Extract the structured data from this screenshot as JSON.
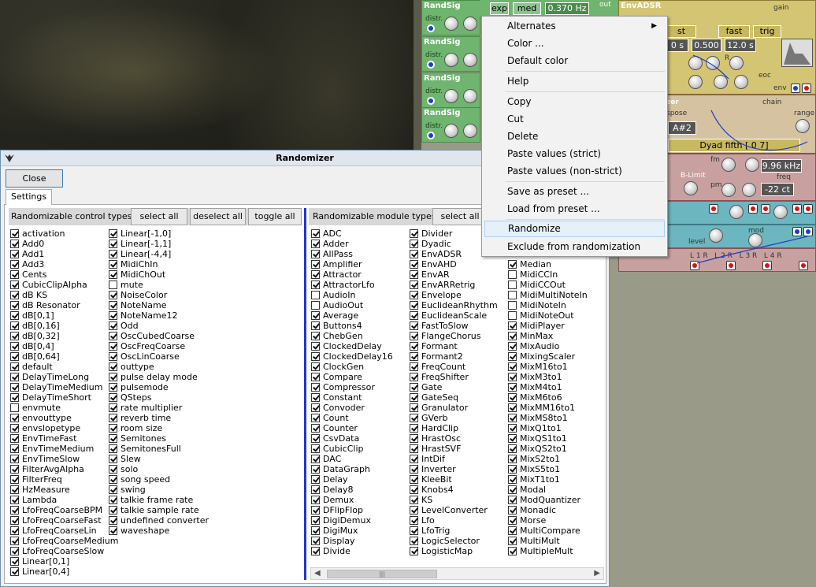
{
  "patch": {
    "randsig_title": "RandSig",
    "randsig_distr": "distr.",
    "topbar": {
      "exp": "exp",
      "med": "med",
      "freq": "0.370 Hz",
      "out": "out"
    },
    "envadsr": {
      "title": "EnvADSR",
      "gain": "gain",
      "btn1": "st",
      "fast": "fast",
      "trig": "trig",
      "v1": "0 s",
      "v2": "0.500",
      "v3": "12.0 s",
      "r": "R",
      "eoc": "eoc",
      "env": "env"
    },
    "quantizer": {
      "title": "zer",
      "transpose": "spose",
      "chain": "chain",
      "range": "range",
      "note": "A#2",
      "dyad": "Dyad fifth [ 0 7]"
    },
    "filter": {
      "fm": "fm",
      "blimit": "B-Limit",
      "freq": "freq",
      "freq_value": "9.96 kHz",
      "pm": "pm",
      "cents": "-22 ct"
    },
    "mixer": {
      "level": "level",
      "mod": "mod",
      "outs": "L 1 R   L 2 R   L 3 R   L 4 R"
    }
  },
  "window": {
    "title": "Randomizer",
    "close_label": "Close",
    "tab_label": "Settings",
    "control": {
      "header": "Randomizable control types",
      "select_all": "select all",
      "deselect_all": "deselect all",
      "toggle_all": "toggle all",
      "columns": [
        [
          {
            "label": "activation",
            "checked": true
          },
          {
            "label": "Add0",
            "checked": true
          },
          {
            "label": "Add1",
            "checked": true
          },
          {
            "label": "Add3",
            "checked": true
          },
          {
            "label": "Cents",
            "checked": true
          },
          {
            "label": "CubicClipAlpha",
            "checked": true
          },
          {
            "label": "dB KS",
            "checked": true
          },
          {
            "label": "dB Resonator",
            "checked": true
          },
          {
            "label": "dB[0,1]",
            "checked": true
          },
          {
            "label": "dB[0,16]",
            "checked": true
          },
          {
            "label": "dB[0,32]",
            "checked": true
          },
          {
            "label": "dB[0,4]",
            "checked": true
          },
          {
            "label": "dB[0,64]",
            "checked": true
          },
          {
            "label": "default",
            "checked": true
          },
          {
            "label": "DelayTimeLong",
            "checked": true
          },
          {
            "label": "DelayTimeMedium",
            "checked": true
          },
          {
            "label": "DelayTimeShort",
            "checked": true
          },
          {
            "label": "envmute",
            "checked": false
          },
          {
            "label": "envouttype",
            "checked": true
          },
          {
            "label": "envslopetype",
            "checked": true
          },
          {
            "label": "EnvTimeFast",
            "checked": true
          },
          {
            "label": "EnvTimeMedium",
            "checked": true
          },
          {
            "label": "EnvTimeSlow",
            "checked": true
          },
          {
            "label": "FilterAvgAlpha",
            "checked": true
          },
          {
            "label": "FilterFreq",
            "checked": true
          },
          {
            "label": "HzMeasure",
            "checked": true
          },
          {
            "label": "Lambda",
            "checked": true
          },
          {
            "label": "LfoFreqCoarseBPM",
            "checked": true
          },
          {
            "label": "LfoFreqCoarseFast",
            "checked": true
          },
          {
            "label": "LfoFreqCoarseLin",
            "checked": true
          },
          {
            "label": "LfoFreqCoarseMedium",
            "checked": true
          },
          {
            "label": "LfoFreqCoarseSlow",
            "checked": true
          },
          {
            "label": "Linear[0,1]",
            "checked": true
          },
          {
            "label": "Linear[0,4]",
            "checked": true
          }
        ],
        [
          {
            "label": "Linear[-1,0]",
            "checked": true
          },
          {
            "label": "Linear[-1,1]",
            "checked": true
          },
          {
            "label": "Linear[-4,4]",
            "checked": true
          },
          {
            "label": "MidiChIn",
            "checked": true
          },
          {
            "label": "MidiChOut",
            "checked": true
          },
          {
            "label": "mute",
            "checked": false
          },
          {
            "label": "NoiseColor",
            "checked": true
          },
          {
            "label": "NoteName",
            "checked": true
          },
          {
            "label": "NoteName12",
            "checked": true
          },
          {
            "label": "Odd",
            "checked": true
          },
          {
            "label": "OscCubedCoarse",
            "checked": true
          },
          {
            "label": "OscFreqCoarse",
            "checked": true
          },
          {
            "label": "OscLinCoarse",
            "checked": true
          },
          {
            "label": "outtype",
            "checked": true
          },
          {
            "label": "pulse delay mode",
            "checked": true
          },
          {
            "label": "pulsemode",
            "checked": true
          },
          {
            "label": "QSteps",
            "checked": true
          },
          {
            "label": "rate multiplier",
            "checked": true
          },
          {
            "label": "reverb time",
            "checked": true
          },
          {
            "label": "room size",
            "checked": true
          },
          {
            "label": "Semitones",
            "checked": true
          },
          {
            "label": "SemitonesFull",
            "checked": true
          },
          {
            "label": "Slew",
            "checked": true
          },
          {
            "label": "solo",
            "checked": true
          },
          {
            "label": "song speed",
            "checked": true
          },
          {
            "label": "swing",
            "checked": true
          },
          {
            "label": "talkie frame rate",
            "checked": true
          },
          {
            "label": "talkie sample rate",
            "checked": true
          },
          {
            "label": "undefined converter",
            "checked": true
          },
          {
            "label": "waveshape",
            "checked": true
          }
        ]
      ]
    },
    "module": {
      "header": "Randomizable module types",
      "select_all": "select all",
      "columns": [
        [
          {
            "label": "ADC",
            "checked": true
          },
          {
            "label": "Adder",
            "checked": true
          },
          {
            "label": "AllPass",
            "checked": true
          },
          {
            "label": "Amplifier",
            "checked": true
          },
          {
            "label": "Attractor",
            "checked": true
          },
          {
            "label": "AttractorLfo",
            "checked": true
          },
          {
            "label": "AudioIn",
            "checked": false
          },
          {
            "label": "AudioOut",
            "checked": false
          },
          {
            "label": "Average",
            "checked": true
          },
          {
            "label": "Buttons4",
            "checked": true
          },
          {
            "label": "ChebGen",
            "checked": true
          },
          {
            "label": "ClockedDelay",
            "checked": true
          },
          {
            "label": "ClockedDelay16",
            "checked": true
          },
          {
            "label": "ClockGen",
            "checked": true
          },
          {
            "label": "Compare",
            "checked": true
          },
          {
            "label": "Compressor",
            "checked": true
          },
          {
            "label": "Constant",
            "checked": true
          },
          {
            "label": "Convoder",
            "checked": true
          },
          {
            "label": "Count",
            "checked": true
          },
          {
            "label": "Counter",
            "checked": true
          },
          {
            "label": "CsvData",
            "checked": true
          },
          {
            "label": "CubicClip",
            "checked": true
          },
          {
            "label": "DAC",
            "checked": true
          },
          {
            "label": "DataGraph",
            "checked": true
          },
          {
            "label": "Delay",
            "checked": true
          },
          {
            "label": "Delay8",
            "checked": true
          },
          {
            "label": "Demux",
            "checked": true
          },
          {
            "label": "DFlipFlop",
            "checked": true
          },
          {
            "label": "DigiDemux",
            "checked": true
          },
          {
            "label": "DigiMux",
            "checked": true
          },
          {
            "label": "Display",
            "checked": true
          },
          {
            "label": "Divide",
            "checked": true
          }
        ],
        [
          {
            "label": "Divider",
            "checked": true
          },
          {
            "label": "Dyadic",
            "checked": true
          },
          {
            "label": "EnvADSR",
            "checked": true
          },
          {
            "label": "EnvAHD",
            "checked": true
          },
          {
            "label": "EnvAR",
            "checked": true
          },
          {
            "label": "EnvARRetrig",
            "checked": true
          },
          {
            "label": "Envelope",
            "checked": true
          },
          {
            "label": "EuclideanRhythm",
            "checked": true
          },
          {
            "label": "EuclideanScale",
            "checked": true
          },
          {
            "label": "FastToSlow",
            "checked": true
          },
          {
            "label": "FlangeChorus",
            "checked": true
          },
          {
            "label": "Formant",
            "checked": true
          },
          {
            "label": "Formant2",
            "checked": true
          },
          {
            "label": "FreqCount",
            "checked": true
          },
          {
            "label": "FreqShifter",
            "checked": true
          },
          {
            "label": "Gate",
            "checked": true
          },
          {
            "label": "GateSeq",
            "checked": true
          },
          {
            "label": "Granulator",
            "checked": true
          },
          {
            "label": "GVerb",
            "checked": true
          },
          {
            "label": "HardClip",
            "checked": true
          },
          {
            "label": "HrastOsc",
            "checked": true
          },
          {
            "label": "HrastSVF",
            "checked": true
          },
          {
            "label": "IntDif",
            "checked": true
          },
          {
            "label": "Inverter",
            "checked": true
          },
          {
            "label": "KleeBit",
            "checked": true
          },
          {
            "label": "Knobs4",
            "checked": true
          },
          {
            "label": "KS",
            "checked": true
          },
          {
            "label": "LevelConverter",
            "checked": true
          },
          {
            "label": "Lfo",
            "checked": true
          },
          {
            "label": "LfoTrig",
            "checked": true
          },
          {
            "label": "LogicSelector",
            "checked": true
          },
          {
            "label": "LogisticMap",
            "checked": true
          }
        ],
        [
          {
            "label": "",
            "checked": null
          },
          {
            "label": "",
            "checked": null
          },
          {
            "label": "",
            "checked": null
          },
          {
            "label": "Median",
            "checked": true
          },
          {
            "label": "MidiCCIn",
            "checked": false
          },
          {
            "label": "MidiCCOut",
            "checked": false
          },
          {
            "label": "MidiMultiNoteIn",
            "checked": false
          },
          {
            "label": "MidiNoteIn",
            "checked": false
          },
          {
            "label": "MidiNoteOut",
            "checked": false
          },
          {
            "label": "MidiPlayer",
            "checked": true
          },
          {
            "label": "MinMax",
            "checked": true
          },
          {
            "label": "MixAudio",
            "checked": true
          },
          {
            "label": "MixingScaler",
            "checked": true
          },
          {
            "label": "MixM16to1",
            "checked": true
          },
          {
            "label": "MixM3to1",
            "checked": true
          },
          {
            "label": "MixM4to1",
            "checked": true
          },
          {
            "label": "MixM6to6",
            "checked": true
          },
          {
            "label": "MixMM16to1",
            "checked": true
          },
          {
            "label": "MixMS8to1",
            "checked": true
          },
          {
            "label": "MixQ1to1",
            "checked": true
          },
          {
            "label": "MixQS1to1",
            "checked": true
          },
          {
            "label": "MixQS2to1",
            "checked": true
          },
          {
            "label": "MixS2to1",
            "checked": true
          },
          {
            "label": "MixS5to1",
            "checked": true
          },
          {
            "label": "MixT1to1",
            "checked": true
          },
          {
            "label": "Modal",
            "checked": true
          },
          {
            "label": "ModQuantizer",
            "checked": true
          },
          {
            "label": "Monadic",
            "checked": true
          },
          {
            "label": "Morse",
            "checked": true
          },
          {
            "label": "MultiCompare",
            "checked": true
          },
          {
            "label": "MultiMult",
            "checked": true
          },
          {
            "label": "MultipleMult",
            "checked": true
          }
        ]
      ]
    },
    "scroll_thumb": "|||"
  },
  "menu": {
    "items": [
      {
        "label": "Alternates",
        "submenu": true
      },
      {
        "label": "Color ..."
      },
      {
        "label": "Default color"
      },
      {
        "label": "Help"
      },
      {
        "label": "Copy"
      },
      {
        "label": "Cut"
      },
      {
        "label": "Delete"
      },
      {
        "label": "Paste values (strict)"
      },
      {
        "label": "Paste values (non-strict)"
      },
      {
        "label": "Save as preset ..."
      },
      {
        "label": "Load from preset ..."
      },
      {
        "label": "Randomize",
        "highlighted": true
      },
      {
        "label": "Exclude from randomization"
      }
    ]
  }
}
